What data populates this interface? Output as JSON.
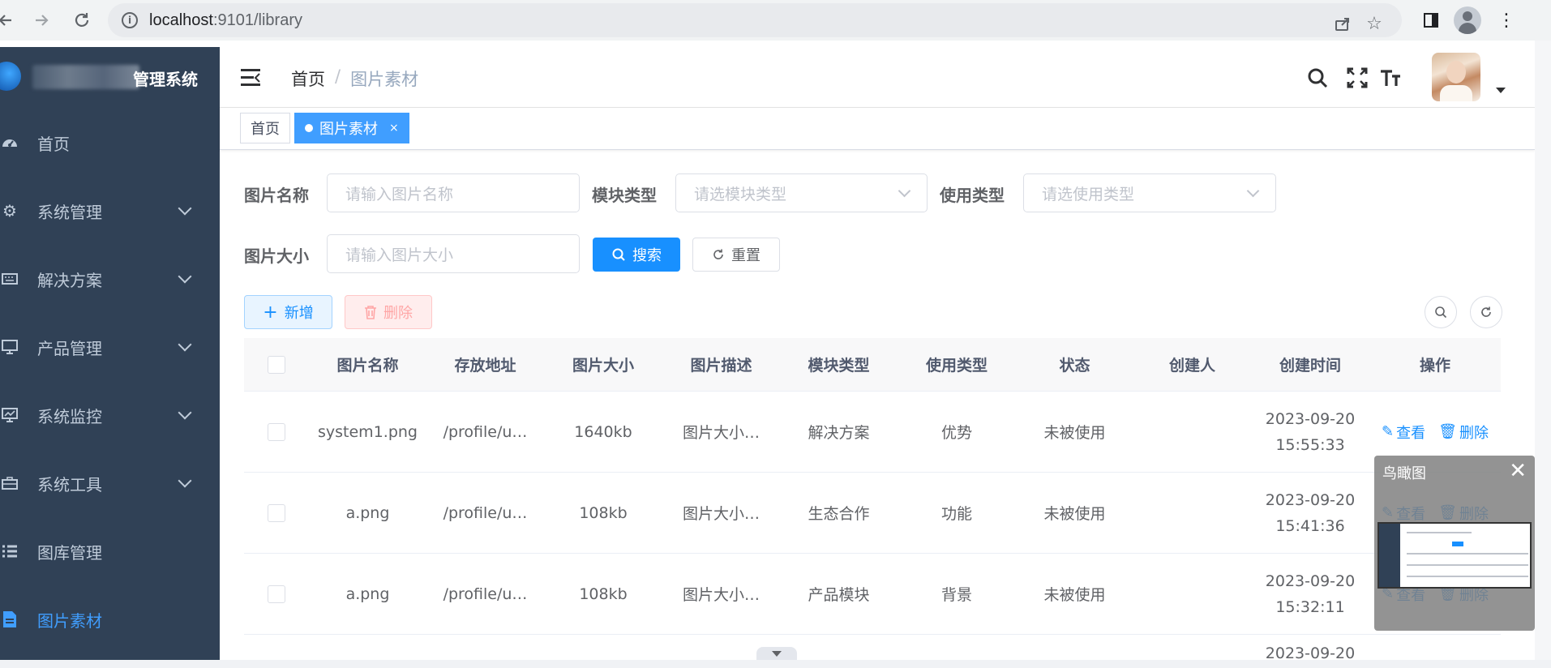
{
  "browser": {
    "url_host": "localhost",
    "url_rest": ":9101/library"
  },
  "sidebar": {
    "brand_suffix": "管理系统",
    "items": [
      {
        "label": "首页",
        "icon": "dashboard-icon",
        "active": false,
        "has_children": false
      },
      {
        "label": "系统管理",
        "icon": "gear-icon",
        "active": false,
        "has_children": true
      },
      {
        "label": "解决方案",
        "icon": "keyboard-icon",
        "active": false,
        "has_children": true
      },
      {
        "label": "产品管理",
        "icon": "monitor-icon",
        "active": false,
        "has_children": true
      },
      {
        "label": "系统监控",
        "icon": "chart-monitor-icon",
        "active": false,
        "has_children": true
      },
      {
        "label": "系统工具",
        "icon": "toolbox-icon",
        "active": false,
        "has_children": true
      },
      {
        "label": "图库管理",
        "icon": "list-icon",
        "active": false,
        "has_children": false
      },
      {
        "label": "图片素材",
        "icon": "document-icon",
        "active": true,
        "has_children": false
      }
    ]
  },
  "header": {
    "breadcrumb_home": "首页",
    "breadcrumb_sep": "/",
    "breadcrumb_current": "图片素材"
  },
  "tags": {
    "home": "首页",
    "current": "图片素材",
    "close": "×"
  },
  "search": {
    "name_label": "图片名称",
    "name_placeholder": "请输入图片名称",
    "module_label": "模块类型",
    "module_placeholder": "请选模块类型",
    "usage_label": "使用类型",
    "usage_placeholder": "请选使用类型",
    "size_label": "图片大小",
    "size_placeholder": "请输入图片大小",
    "search_button": "搜索",
    "reset_button": "重置"
  },
  "toolbar": {
    "add_button": "新增",
    "delete_button": "删除"
  },
  "table": {
    "columns": [
      "图片名称",
      "存放地址",
      "图片大小",
      "图片描述",
      "模块类型",
      "使用类型",
      "状态",
      "创建人",
      "创建时间",
      "操作"
    ],
    "rows": [
      {
        "name": "system1.png",
        "path": "/profile/u…",
        "size": "1640kb",
        "desc": "图片大小…",
        "module": "解决方案",
        "usage": "优势",
        "status": "未被使用",
        "creator": "",
        "date": "2023-09-20",
        "time": "15:55:33"
      },
      {
        "name": "a.png",
        "path": "/profile/u…",
        "size": "108kb",
        "desc": "图片大小…",
        "module": "生态合作",
        "usage": "功能",
        "status": "未被使用",
        "creator": "",
        "date": "2023-09-20",
        "time": "15:41:36"
      },
      {
        "name": "a.png",
        "path": "/profile/u…",
        "size": "108kb",
        "desc": "图片大小…",
        "module": "产品模块",
        "usage": "背景",
        "status": "未被使用",
        "creator": "",
        "date": "2023-09-20",
        "time": "15:32:11"
      }
    ],
    "partial_row_date": "2023-09-20",
    "view_action": "查看",
    "delete_action": "删除"
  },
  "minimap": {
    "title": "鸟瞰图",
    "close": "✕"
  },
  "colors": {
    "sidebar_bg": "#304156",
    "accent": "#1890ff",
    "active_menu": "#409eff"
  }
}
